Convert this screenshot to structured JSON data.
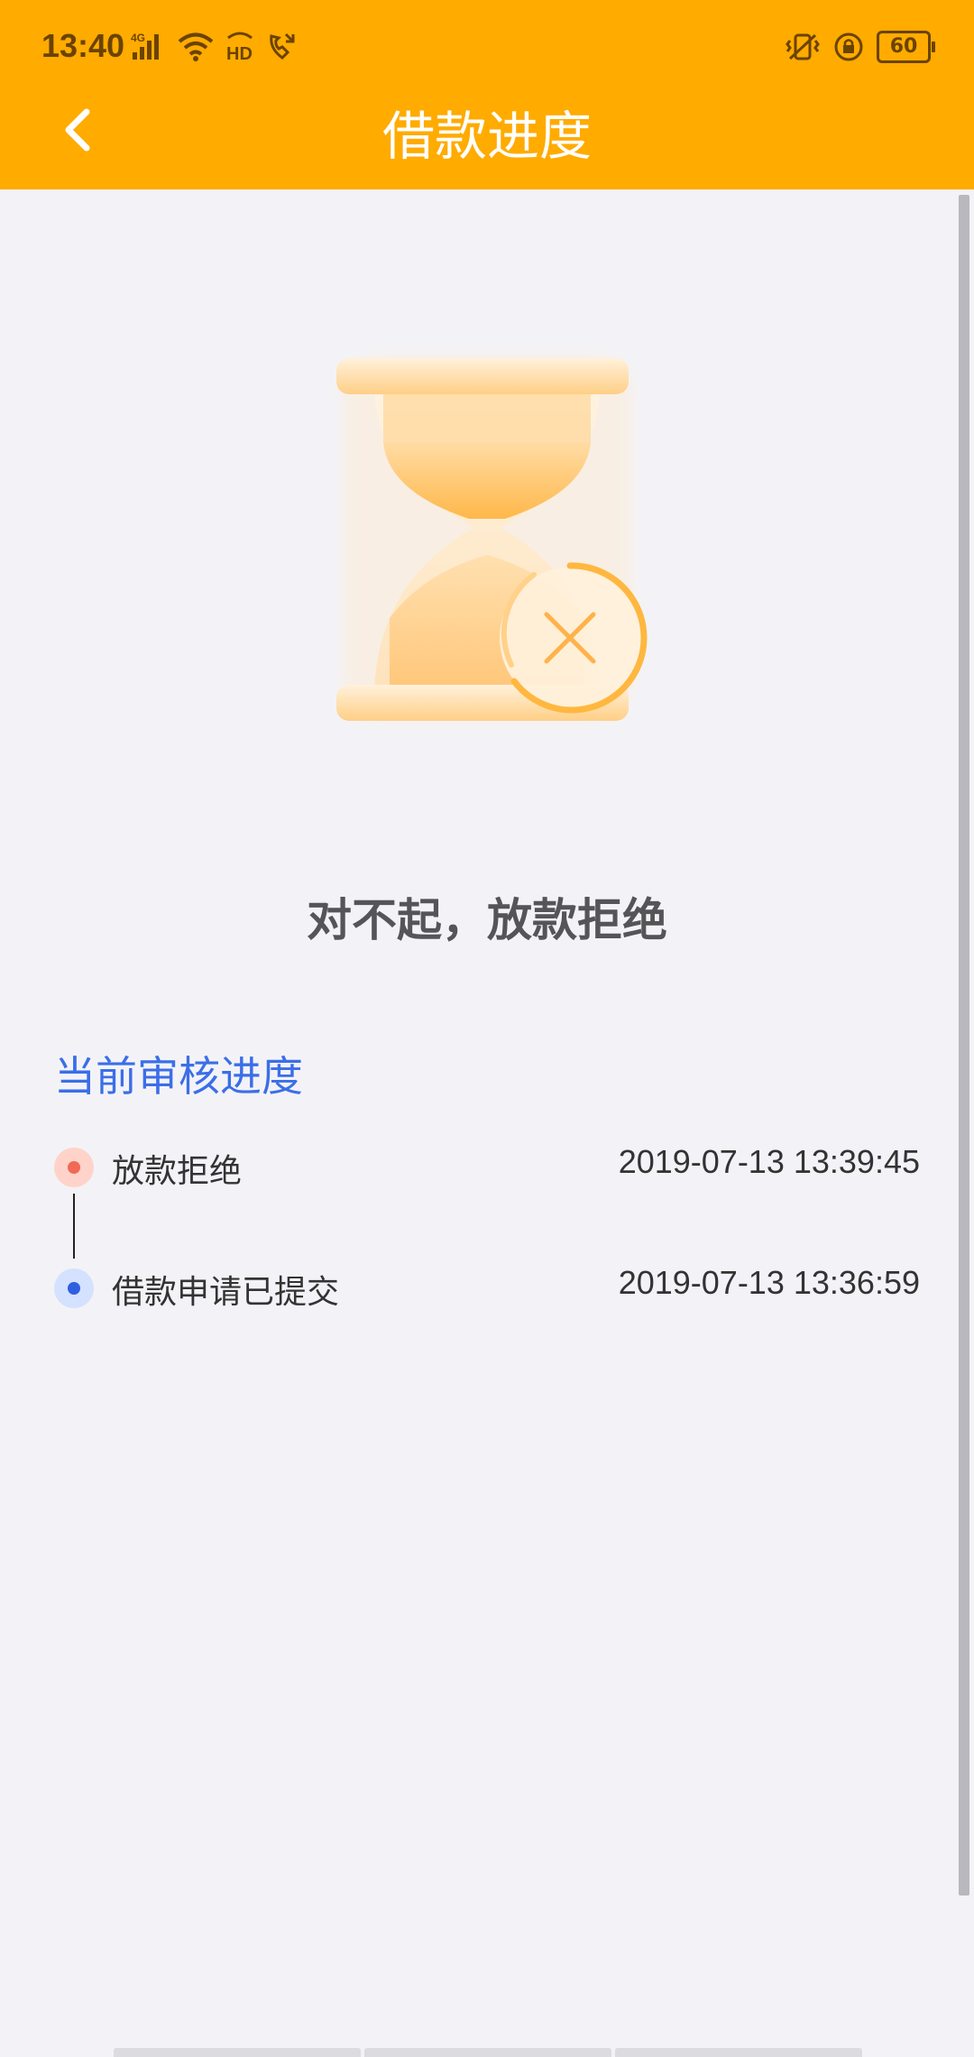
{
  "status_bar": {
    "time": "13:40",
    "battery": "60",
    "icons": [
      "signal-4g-icon",
      "wifi-icon",
      "hd-icon",
      "call-icon",
      "vibrate-icon",
      "rotation-lock-icon",
      "battery-icon"
    ]
  },
  "nav": {
    "title": "借款进度",
    "back_icon": "chevron-left-icon"
  },
  "result": {
    "title": "对不起，放款拒绝",
    "icon": "hourglass-reject-icon"
  },
  "progress": {
    "section_title": "当前审核进度",
    "steps": [
      {
        "label": "放款拒绝",
        "time": "2019-07-13 13:39:45",
        "dot_color": "#f06a55",
        "dot_bg": "#ffd3ca"
      },
      {
        "label": "借款申请已提交",
        "time": "2019-07-13 13:36:59",
        "dot_color": "#2f5fe0",
        "dot_bg": "#d4e1ff"
      }
    ]
  },
  "colors": {
    "header": "#ffab00",
    "accent_blue": "#3b6ee8",
    "background": "#f3f3f7"
  }
}
